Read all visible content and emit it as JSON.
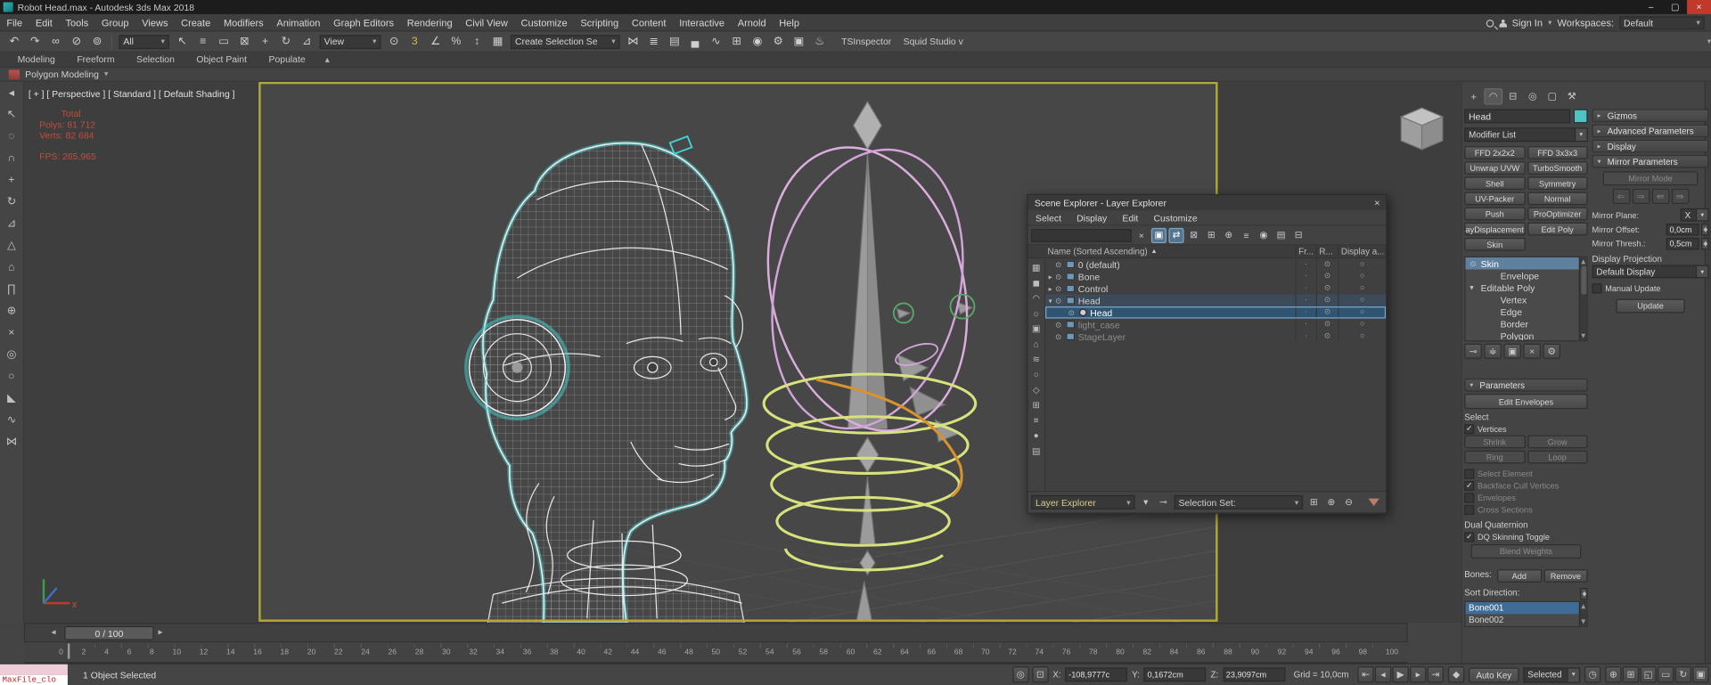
{
  "window": {
    "title": "Robot Head.max - Autodesk 3ds Max 2018",
    "min": "–",
    "max": "▢",
    "close": "×"
  },
  "ui": {
    "chevron_down": "▾",
    "chevron_up": "▴",
    "tri_right": "▸",
    "tri_down": "▾",
    "check": "✓",
    "sort_asc": "▲",
    "slider_left": "◂",
    "slider_right": "▸"
  },
  "menu": {
    "items": [
      "File",
      "Edit",
      "Tools",
      "Group",
      "Views",
      "Create",
      "Modifiers",
      "Animation",
      "Graph Editors",
      "Rendering",
      "Civil View",
      "Customize",
      "Scripting",
      "Content",
      "Interactive",
      "Arnold",
      "Help"
    ],
    "sign_in": "Sign In",
    "workspaces_label": "Workspaces:",
    "workspaces_value": "Default"
  },
  "toolbar": {
    "icons_a": [
      {
        "name": "undo-icon",
        "glyph": "↶"
      },
      {
        "name": "redo-icon",
        "glyph": "↷"
      },
      {
        "name": "select-and-link-icon",
        "glyph": "∞"
      },
      {
        "name": "unlink-selection-icon",
        "glyph": "⊘"
      },
      {
        "name": "bind-to-space-warp-icon",
        "glyph": "⊚"
      }
    ],
    "filter_value": "All",
    "icons_b": [
      {
        "name": "select-object-icon",
        "glyph": "↖"
      },
      {
        "name": "select-by-name-icon",
        "glyph": "≡"
      },
      {
        "name": "rectangular-selection-region-icon",
        "glyph": "▭"
      },
      {
        "name": "window-crossing-icon",
        "glyph": "⊠"
      },
      {
        "name": "select-and-move-icon",
        "glyph": "+"
      },
      {
        "name": "select-and-rotate-icon",
        "glyph": "↻"
      },
      {
        "name": "select-and-scale-icon",
        "glyph": "⊿"
      }
    ],
    "ref_coord_value": "View",
    "icons_c": [
      {
        "name": "use-pivot-point-icon",
        "glyph": "⊙"
      },
      {
        "name": "snaps-toggle-icon",
        "glyph": "3",
        "tint": "y"
      },
      {
        "name": "angle-snap-icon",
        "glyph": "∠"
      },
      {
        "name": "percent-snap-icon",
        "glyph": "%"
      },
      {
        "name": "spinner-snap-icon",
        "glyph": "↕"
      },
      {
        "name": "edit-named-selection-sets-icon",
        "glyph": "▦"
      }
    ],
    "named_sets_value": "Create Selection Se",
    "icons_d": [
      {
        "name": "mirror-icon",
        "glyph": "⋈"
      },
      {
        "name": "align-icon",
        "glyph": "≣"
      },
      {
        "name": "layer-manager-icon",
        "glyph": "▤"
      },
      {
        "name": "ribbon-toggle-icon",
        "glyph": "▄"
      },
      {
        "name": "curve-editor-icon",
        "glyph": "∿"
      },
      {
        "name": "schematic-view-icon",
        "glyph": "⊞"
      },
      {
        "name": "material-editor-icon",
        "glyph": "◉"
      },
      {
        "name": "render-setup-icon",
        "glyph": "⚙"
      },
      {
        "name": "rendered-frame-window-icon",
        "glyph": "▣"
      },
      {
        "name": "render-production-icon",
        "glyph": "♨"
      }
    ],
    "plugin_label_1": "TSInspector",
    "plugin_label_2": "Squid Studio v"
  },
  "ribbon": {
    "tabs": [
      "Modeling",
      "Freeform",
      "Selection",
      "Object Paint",
      "Populate"
    ],
    "panel_label": "Polygon Modeling"
  },
  "left_toolbar": {
    "icons": [
      {
        "name": "viewport-tab-arrow-icon",
        "glyph": "◂"
      },
      {
        "name": "select-tool-icon",
        "glyph": "↖"
      },
      {
        "name": "lasso-tool-icon",
        "glyph": "◌"
      },
      {
        "name": "snap-magnet-icon",
        "glyph": "∩",
        "tint": "y"
      },
      {
        "name": "move-tool-icon",
        "glyph": "+"
      },
      {
        "name": "rotate-tool-icon",
        "glyph": "↻"
      },
      {
        "name": "scale-tool-icon",
        "glyph": "⊿"
      },
      {
        "name": "extrude-tool-icon",
        "glyph": "△"
      },
      {
        "name": "home-grid-icon",
        "glyph": "⌂"
      },
      {
        "name": "bridge-tool-icon",
        "glyph": "∏"
      },
      {
        "name": "weld-tool-icon",
        "glyph": "⊕"
      },
      {
        "name": "cut-tool-icon",
        "glyph": "×"
      },
      {
        "name": "loop-tool-icon",
        "glyph": "◎"
      },
      {
        "name": "ring-tool-icon",
        "glyph": "○"
      },
      {
        "name": "chamfer-tool-icon",
        "glyph": "◣"
      },
      {
        "name": "relax-tool-icon",
        "glyph": "∿"
      },
      {
        "name": "mirror-tool-icon",
        "glyph": "⋈"
      }
    ]
  },
  "viewport": {
    "label": "[ + ] [ Perspective ] [ Standard ] [ Default Shading ]",
    "stats": {
      "total": "Total",
      "polys": "Polys: 81 712",
      "verts": "Verts: 82 684",
      "fps": "FPS: 265,965"
    },
    "axis_label": "x"
  },
  "explorer": {
    "title": "Scene Explorer - Layer Explorer",
    "close": "×",
    "menus": [
      "Select",
      "Display",
      "Edit",
      "Customize"
    ],
    "tools": [
      {
        "name": "clear-search-icon",
        "glyph": "×"
      },
      {
        "name": "find-case-icon",
        "glyph": "▣",
        "state": "active"
      },
      {
        "name": "sync-selection-icon",
        "glyph": "⇄",
        "state": "active"
      },
      {
        "name": "lock-cell-editing-icon",
        "glyph": "⊠"
      },
      {
        "name": "create-new-layer-icon",
        "glyph": "⊞"
      },
      {
        "name": "add-selection-to-layer-icon",
        "glyph": "⊕"
      },
      {
        "name": "select-children-icon",
        "glyph": "≡"
      },
      {
        "name": "pick-material-icon",
        "glyph": "◉"
      },
      {
        "name": "highlight-layer-icon",
        "glyph": "▤"
      },
      {
        "name": "delete-layer-icon",
        "glyph": "⊟"
      }
    ],
    "header": {
      "name": "Name (Sorted Ascending)",
      "frozen": "Fr...",
      "render": "R...",
      "display": "Display a..."
    },
    "filters": [
      {
        "name": "display-all-filter-icon",
        "glyph": "▦"
      },
      {
        "name": "display-geometry-filter-icon",
        "glyph": "◼"
      },
      {
        "name": "display-shapes-filter-icon",
        "glyph": "◠"
      },
      {
        "name": "display-lights-filter-icon",
        "glyph": "☼"
      },
      {
        "name": "display-cameras-filter-icon",
        "glyph": "▣"
      },
      {
        "name": "display-helpers-filter-icon",
        "glyph": "⌂"
      },
      {
        "name": "display-spacewarps-filter-icon",
        "glyph": "≋"
      },
      {
        "name": "display-groups-filter-icon",
        "glyph": "○"
      },
      {
        "name": "display-xrefs-filter-icon",
        "glyph": "◇"
      },
      {
        "name": "display-bones-filter-icon",
        "glyph": "⊞"
      },
      {
        "name": "display-containers-filter-icon",
        "glyph": "≡"
      },
      {
        "name": "display-materials-filter-icon",
        "glyph": "●"
      },
      {
        "name": "display-layers-filter-icon",
        "glyph": "▤"
      }
    ],
    "rows": [
      {
        "expander": "",
        "label": "0 (default)",
        "depth": 0,
        "kind": "layer",
        "state": "normal"
      },
      {
        "expander": "▸",
        "label": "Bone",
        "depth": 0,
        "kind": "layer",
        "state": "normal"
      },
      {
        "expander": "▸",
        "label": "Control",
        "depth": 0,
        "kind": "layer",
        "state": "normal"
      },
      {
        "expander": "▾",
        "label": "Head",
        "depth": 0,
        "kind": "layer",
        "state": "current"
      },
      {
        "expander": "",
        "label": "Head",
        "depth": 1,
        "kind": "object",
        "state": "selected"
      },
      {
        "expander": "",
        "label": "light_case",
        "depth": 0,
        "kind": "layer",
        "state": "muted"
      },
      {
        "expander": "",
        "label": "StageLayer",
        "depth": 0,
        "kind": "layer",
        "state": "muted"
      }
    ],
    "footer": {
      "preset_value": "Layer Explorer",
      "selection_set_label": "Selection Set:",
      "icons_a": [
        {
          "name": "explorer-settings-icon",
          "glyph": "▾"
        },
        {
          "name": "pin-explorer-icon",
          "glyph": "⊸"
        }
      ],
      "icons_b": [
        {
          "name": "create-selection-set-icon",
          "glyph": "⊞"
        },
        {
          "name": "add-to-set-icon",
          "glyph": "⊕"
        },
        {
          "name": "subtract-from-set-icon",
          "glyph": "⊖"
        }
      ]
    }
  },
  "cp": {
    "tabs": [
      {
        "name": "create-tab",
        "glyph": "+",
        "state": "normal"
      },
      {
        "name": "modify-tab",
        "glyph": "◠",
        "state": "active"
      },
      {
        "name": "hierarchy-tab",
        "glyph": "⊟",
        "state": "normal"
      },
      {
        "name": "motion-tab",
        "glyph": "◎",
        "state": "normal"
      },
      {
        "name": "display-tab",
        "glyph": "▢",
        "state": "normal"
      },
      {
        "name": "utilities-tab",
        "glyph": "⚒",
        "state": "normal"
      }
    ],
    "object_name": "Head",
    "object_color": "#53c2c2",
    "modifier_list_label": "Modifier List",
    "modifiers": [
      "FFD 2x2x2",
      "FFD 3x3x3",
      "Unwrap UVW",
      "TurboSmooth",
      "Shell",
      "Symmetry",
      "UV-Packer",
      "Normal",
      "Push",
      "ProOptimizer",
      "ayDisplacementM",
      "Edit Poly",
      "Skin"
    ],
    "stack": [
      {
        "icon": "⊙",
        "label": "Skin",
        "depth": 0,
        "state": "selected"
      },
      {
        "icon": "",
        "label": "Envelope",
        "depth": 1,
        "state": "normal"
      },
      {
        "icon": "▾",
        "label": "Editable Poly",
        "depth": 0,
        "state": "normal"
      },
      {
        "icon": "",
        "label": "Vertex",
        "depth": 1,
        "state": "normal"
      },
      {
        "icon": "",
        "label": "Edge",
        "depth": 1,
        "state": "normal"
      },
      {
        "icon": "",
        "label": "Border",
        "depth": 1,
        "state": "normal"
      },
      {
        "icon": "",
        "label": "Polygon",
        "depth": 1,
        "state": "normal"
      }
    ],
    "stack_tools": [
      {
        "name": "pin-stack-icon",
        "glyph": "⊸"
      },
      {
        "name": "show-end-result-icon",
        "glyph": "≑"
      },
      {
        "name": "make-unique-icon",
        "glyph": "▣"
      },
      {
        "name": "remove-modifier-icon",
        "glyph": "×"
      },
      {
        "name": "configure-modifier-sets-icon",
        "glyph": "⚙"
      }
    ],
    "params": {
      "title": "Parameters",
      "edit_envelopes": "Edit Envelopes",
      "select_label": "Select",
      "vertices_label": "Vertices",
      "shrink": "Shrink",
      "grow": "Grow",
      "ring": "Ring",
      "loop": "Loop",
      "select_element": "Select Element",
      "backface": "Backface Cull Vertices",
      "envelopes": "Envelopes",
      "cross_sections": "Cross Sections",
      "dual_quaternion_label": "Dual Quaternion",
      "dq_toggle": "DQ Skinning Toggle",
      "blend_weights": "Blend Weights",
      "bones_label": "Bones:",
      "add": "Add",
      "remove": "Remove",
      "sort_label": "Sort Direction:",
      "bones": [
        {
          "label": "Bone001",
          "state": "selected"
        },
        {
          "label": "Bone002",
          "state": "normal"
        }
      ]
    },
    "rollouts_collapsed": [
      "Gizmos",
      "Advanced Parameters",
      "Display"
    ],
    "mirror": {
      "title": "Mirror Parameters",
      "mirror_mode": "Mirror Mode",
      "paste_icons": [
        {
          "name": "paste-green-to-blue-bones-icon",
          "glyph": "⇐"
        },
        {
          "name": "paste-blue-to-green-bones-icon",
          "glyph": "⇒"
        },
        {
          "name": "paste-green-to-blue-verts-icon",
          "glyph": "⇚"
        },
        {
          "name": "paste-blue-to-green-verts-icon",
          "glyph": "⇛"
        }
      ],
      "plane_label": "Mirror Plane:",
      "plane_value": "X",
      "offset_label": "Mirror Offset:",
      "offset_value": "0,0cm",
      "thresh_label": "Mirror Thresh.:",
      "thresh_value": "0,5cm",
      "projection_label": "Display Projection",
      "projection_value": "Default Display",
      "manual_update": "Manual Update",
      "update": "Update"
    }
  },
  "timeline": {
    "slider_label": "0 / 100",
    "ticks": [
      0,
      2,
      4,
      6,
      8,
      10,
      12,
      14,
      16,
      18,
      20,
      22,
      24,
      26,
      28,
      30,
      32,
      34,
      36,
      38,
      40,
      42,
      44,
      46,
      48,
      50,
      52,
      54,
      56,
      58,
      60,
      62,
      64,
      66,
      68,
      70,
      72,
      74,
      76,
      78,
      80,
      82,
      84,
      86,
      88,
      90,
      92,
      94,
      96,
      98,
      100
    ]
  },
  "status": {
    "listener_text": "MaxFile_clo",
    "selection": "1 Object Selected",
    "toggles": [
      {
        "name": "isolate-selection-icon",
        "glyph": "◎"
      },
      {
        "name": "lock-selection-icon",
        "glyph": "⊡"
      }
    ],
    "x_label": "X:",
    "x_value": "-108,9777c",
    "y_label": "Y:",
    "y_value": "0,1672cm",
    "z_label": "Z:",
    "z_value": "23,9097cm",
    "grid": "Grid = 10,0cm",
    "playback": [
      {
        "name": "go-to-start-icon",
        "glyph": "⇤"
      },
      {
        "name": "previous-frame-icon",
        "glyph": "◂"
      },
      {
        "name": "play-icon",
        "glyph": "▶"
      },
      {
        "name": "next-frame-icon",
        "glyph": "▸"
      },
      {
        "name": "go-to-end-icon",
        "glyph": "⇥"
      }
    ],
    "set_key_glyph": "◆",
    "auto_key": "Auto Key",
    "key_filter_value": "Selected",
    "time_config_glyph": "◷",
    "nav": [
      {
        "name": "zoom-icon",
        "glyph": "⊕"
      },
      {
        "name": "zoom-all-icon",
        "glyph": "⊞"
      },
      {
        "name": "zoom-extents-icon",
        "glyph": "◱"
      },
      {
        "name": "zoom-region-icon",
        "glyph": "▭"
      },
      {
        "name": "orbit-icon",
        "glyph": "↻"
      },
      {
        "name": "maximize-viewport-icon",
        "glyph": "▣"
      }
    ]
  }
}
